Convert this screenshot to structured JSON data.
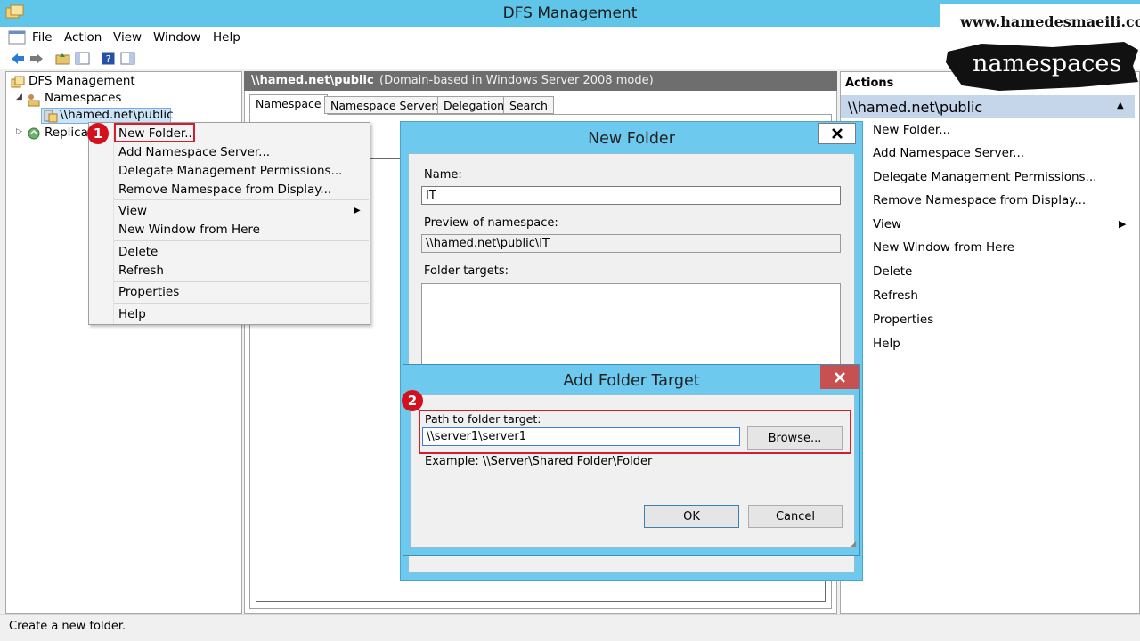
{
  "window": {
    "title": "DFS Management"
  },
  "menu": [
    "File",
    "Action",
    "View",
    "Window",
    "Help"
  ],
  "tree": {
    "root": "DFS Management",
    "namespaces": "Namespaces",
    "namespace_item": "\\\\hamed.net\\public",
    "replication": "Replica"
  },
  "center": {
    "header_path": "\\\\hamed.net\\public",
    "header_mode": "(Domain-based in Windows Server 2008 mode)",
    "tabs": [
      "Namespace",
      "Namespace Servers",
      "Delegation",
      "Search"
    ]
  },
  "actions": {
    "title": "Actions",
    "section": "\\\\hamed.net\\public",
    "items": [
      "New Folder...",
      "Add Namespace Server...",
      "Delegate Management Permissions...",
      "Remove Namespace from Display...",
      "View",
      "New Window from Here",
      "Delete",
      "Refresh",
      "Properties",
      "Help"
    ]
  },
  "context_menu": {
    "items": [
      "New Folder...",
      "Add Namespace Server...",
      "Delegate Management Permissions...",
      "Remove Namespace from Display...",
      "View",
      "New Window from Here",
      "Delete",
      "Refresh",
      "Properties",
      "Help"
    ]
  },
  "new_folder_dialog": {
    "title": "New Folder",
    "name_label": "Name:",
    "name_value": "IT",
    "preview_label": "Preview of namespace:",
    "preview_value": "\\\\hamed.net\\public\\IT",
    "targets_label": "Folder targets:"
  },
  "add_target_dialog": {
    "title": "Add Folder Target",
    "path_label": "Path to folder target:",
    "path_value": "\\\\server1\\server1",
    "browse_label": "Browse...",
    "example": "Example: \\\\Server\\Shared Folder\\Folder",
    "ok_label": "OK",
    "cancel_label": "Cancel"
  },
  "badges": [
    "1",
    "2"
  ],
  "status": "Create a new folder.",
  "watermark": {
    "url": "www.hamedesmaeili.com",
    "label": "namespaces"
  },
  "colors": {
    "titlebar": "#5fc6ea",
    "dialog_frame": "#6ec9ee",
    "highlight": "#d0202b",
    "actions_section": "#c5d6ea"
  }
}
